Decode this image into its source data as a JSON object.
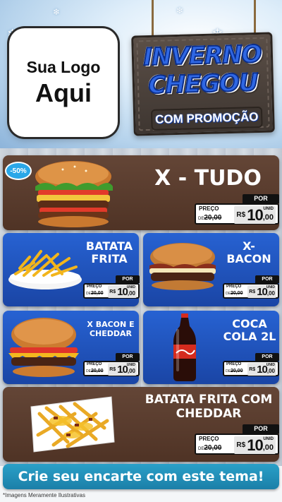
{
  "header": {
    "logo_line1": "Sua Logo",
    "logo_line2": "Aqui",
    "sign_line1": "INVERNO",
    "sign_line2": "CHEGOU",
    "sign_line3": "COM PROMOÇÃO"
  },
  "colors": {
    "wood": "#5a3a2a",
    "blue_panel": "#1d4fb8",
    "cta": "#2aa0c8",
    "sign_text": "#2f67e4"
  },
  "products": [
    {
      "id": "x-tudo",
      "title": "X - TUDO",
      "badge": "-50%",
      "price": {
        "por": "POR",
        "preco": "PREÇO",
        "de": "DE",
        "old": "20,00",
        "currency": "R$",
        "integer": "10",
        "decimal": ",00",
        "unit": "UNID"
      }
    },
    {
      "id": "batata-frita",
      "title_l1": "BATATA",
      "title_l2": "FRITA",
      "price": {
        "por": "POR",
        "preco": "PREÇO",
        "de": "DE",
        "old": "20,00",
        "currency": "R$",
        "integer": "10",
        "decimal": ",00",
        "unit": "UNID"
      }
    },
    {
      "id": "x-bacon",
      "title_l1": "X-",
      "title_l2": "BACON",
      "price": {
        "por": "POR",
        "preco": "PREÇO",
        "de": "DE",
        "old": "20,00",
        "currency": "R$",
        "integer": "10",
        "decimal": ",00",
        "unit": "UNID"
      }
    },
    {
      "id": "x-bacon-cheddar",
      "title_l1": "X BACON E",
      "title_l2": "CHEDDAR",
      "price": {
        "por": "POR",
        "preco": "PREÇO",
        "de": "DE",
        "old": "20,00",
        "currency": "R$",
        "integer": "10",
        "decimal": ",00",
        "unit": "UNID"
      }
    },
    {
      "id": "coca-cola",
      "title_l1": "COCA",
      "title_l2": "COLA 2L",
      "price": {
        "por": "POR",
        "preco": "PREÇO",
        "de": "DE",
        "old": "20,00",
        "currency": "R$",
        "integer": "10",
        "decimal": ",00",
        "unit": "UNID"
      }
    },
    {
      "id": "batata-cheddar",
      "title_l1": "BATATA FRITA COM",
      "title_l2": "CHEDDAR",
      "price": {
        "por": "POR",
        "preco": "PREÇO",
        "de": "DE",
        "old": "20,00",
        "currency": "R$",
        "integer": "10",
        "decimal": ",00",
        "unit": "UNID"
      }
    }
  ],
  "footer": {
    "cta": "Crie seu encarte com este tema!",
    "disclaimer": "*Imagens Meramente Ilustrativas"
  }
}
